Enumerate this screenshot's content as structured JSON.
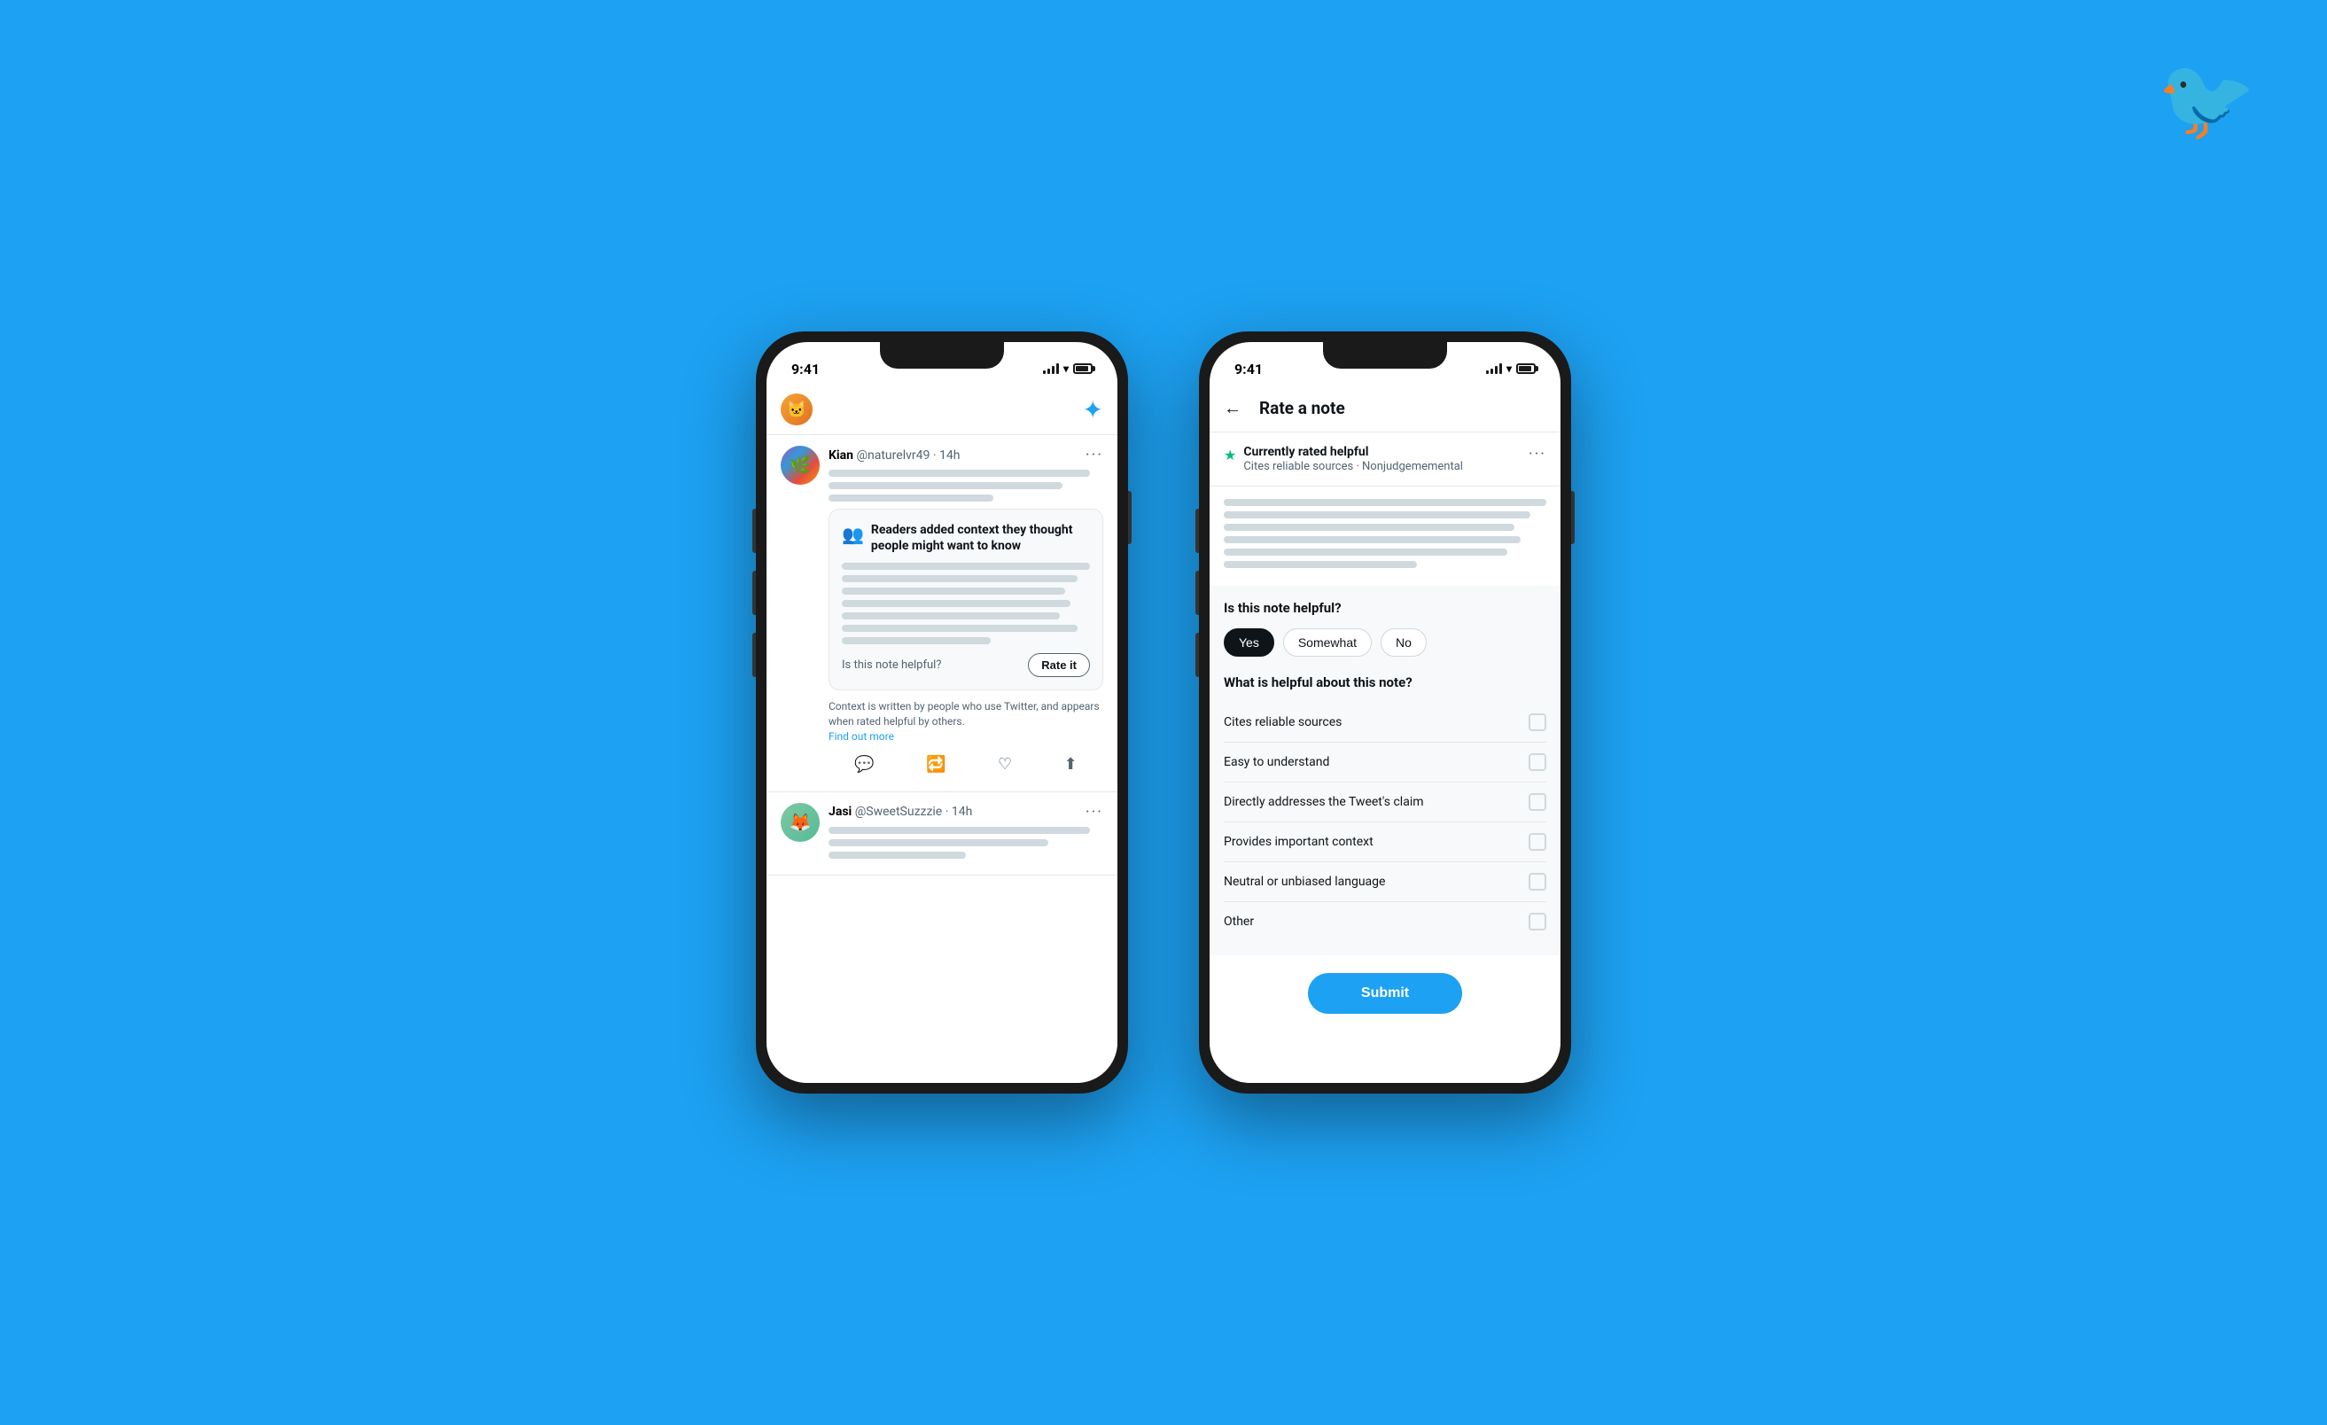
{
  "background_color": "#1DA1F2",
  "twitter_logo": "🐦",
  "phone1": {
    "status_time": "9:41",
    "feed_header": {
      "sparkle": "✦"
    },
    "tweet1": {
      "author_name": "Kian",
      "author_handle": "@naturelvr49 · 14h",
      "more_dots": "···"
    },
    "context_card": {
      "icon": "👥",
      "title": "Readers added context they thought people might want to know",
      "helpful_text": "Is this note helpful?",
      "rate_button": "Rate it",
      "note_text": "Context is written by people who use Twitter, and appears when rated helpful by others.",
      "find_out_more": "Find out more"
    },
    "tweet2": {
      "author_name": "Jasi",
      "author_handle": "@SweetSuzzzie · 14h",
      "more_dots": "···"
    }
  },
  "phone2": {
    "status_time": "9:41",
    "header": {
      "back_arrow": "←",
      "title": "Rate a note"
    },
    "rated_helpful": {
      "star": "★",
      "label": "Currently rated helpful",
      "tags": "Cites reliable sources · Nonjudgememental",
      "more_dots": "···"
    },
    "helpful_question": "Is this note helpful?",
    "options": [
      {
        "label": "Yes",
        "selected": true
      },
      {
        "label": "Somewhat",
        "selected": false
      },
      {
        "label": "No",
        "selected": false
      }
    ],
    "what_helpful_question": "What is helpful about this note?",
    "checkboxes": [
      {
        "label": "Cites reliable sources"
      },
      {
        "label": "Easy to understand"
      },
      {
        "label": "Directly addresses the Tweet's claim"
      },
      {
        "label": "Provides important context"
      },
      {
        "label": "Neutral or unbiased language"
      },
      {
        "label": "Other"
      }
    ],
    "submit_button": "Submit"
  }
}
